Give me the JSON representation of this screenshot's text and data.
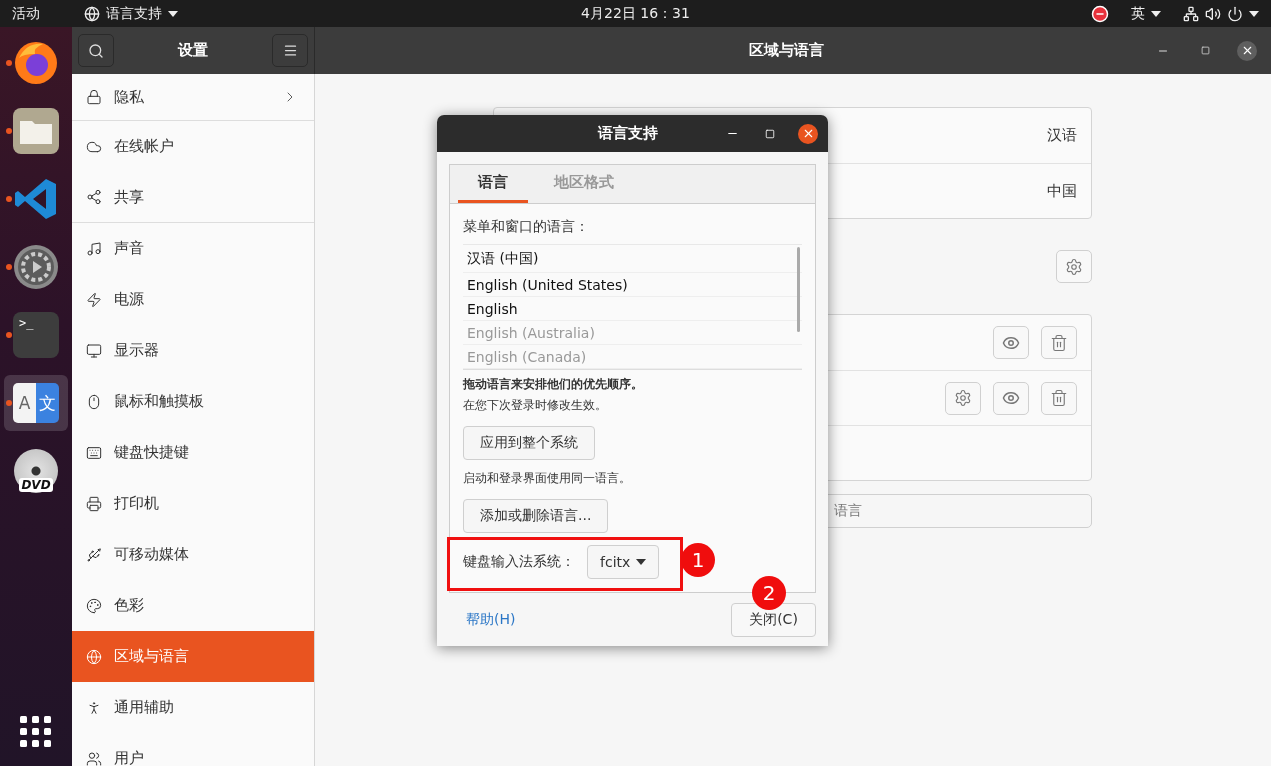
{
  "top_bar": {
    "activities": "活动",
    "app_menu": "语言支持",
    "clock": "4月22日  16：31",
    "input_method": "英"
  },
  "dock": {
    "apps": [
      {
        "kind": "browser",
        "running": true,
        "selected": false
      },
      {
        "kind": "files",
        "running": true,
        "selected": false
      },
      {
        "kind": "editor",
        "running": true,
        "selected": false
      },
      {
        "kind": "settings",
        "running": true,
        "selected": false
      },
      {
        "kind": "terminal",
        "running": true,
        "selected": false,
        "glyph": ">_"
      },
      {
        "kind": "language",
        "running": true,
        "selected": true,
        "glyphs": [
          "A",
          "文"
        ]
      },
      {
        "kind": "dvd",
        "selected": false,
        "glyph": "DVD"
      }
    ]
  },
  "settings_window": {
    "sidebar_title": "设置",
    "title": "区域与语言"
  },
  "sidebar": {
    "items": [
      {
        "label": "隐私",
        "selected": false,
        "has_arrow": true,
        "divider_after": true
      },
      {
        "label": "在线帐户",
        "selected": false,
        "has_arrow": false,
        "divider_after": false
      },
      {
        "label": "共享",
        "selected": false,
        "has_arrow": false,
        "divider_after": true
      },
      {
        "label": "声音",
        "selected": false,
        "has_arrow": false,
        "divider_after": false
      },
      {
        "label": "电源",
        "selected": false,
        "has_arrow": false,
        "divider_after": false
      },
      {
        "label": "显示器",
        "selected": false,
        "has_arrow": false,
        "divider_after": false
      },
      {
        "label": "鼠标和触摸板",
        "selected": false,
        "has_arrow": false,
        "divider_after": false
      },
      {
        "label": "键盘快捷键",
        "selected": false,
        "has_arrow": false,
        "divider_after": false
      },
      {
        "label": "打印机",
        "selected": false,
        "has_arrow": false,
        "divider_after": false
      },
      {
        "label": "可移动媒体",
        "selected": false,
        "has_arrow": false,
        "divider_after": false
      },
      {
        "label": "色彩",
        "selected": false,
        "has_arrow": false,
        "divider_after": false
      },
      {
        "label": "区域与语言",
        "selected": true,
        "has_arrow": false,
        "divider_after": false
      },
      {
        "label": "通用辅助",
        "selected": false,
        "has_arrow": false,
        "divider_after": false
      },
      {
        "label": "用户",
        "selected": false,
        "has_arrow": false,
        "divider_after": false
      }
    ]
  },
  "region_panel": {
    "rows": [
      {
        "value": "汉语"
      },
      {
        "value": "中国"
      }
    ]
  },
  "input_sources": {
    "rows": [
      {
        "has_settings": false,
        "has_actions": true
      },
      {
        "has_settings": true,
        "has_actions": true
      },
      {
        "has_settings": false,
        "has_actions": false
      }
    ]
  },
  "manage_field": {
    "text": "语言"
  },
  "dialog": {
    "title": "语言支持",
    "tabs": [
      {
        "label": "语言",
        "selected": true
      },
      {
        "label": "地区格式",
        "selected": false
      }
    ],
    "list_label": "菜单和窗口的语言：",
    "languages": [
      {
        "label": "汉语 (中国)",
        "dimmed": false
      },
      {
        "label": "English (United States)",
        "dimmed": false
      },
      {
        "label": "English",
        "dimmed": false
      },
      {
        "label": "English (Australia)",
        "dimmed": true
      },
      {
        "label": "English (Canada)",
        "dimmed": true
      }
    ],
    "drag_hint": "拖动语言来安排他们的优先顺序。",
    "login_hint": "在您下次登录时修改生效。",
    "apply_button": "应用到整个系统",
    "login_screen_hint": "启动和登录界面使用同一语言。",
    "add_remove_button": "添加或删除语言...",
    "keyboard_label": "键盘输入法系统：",
    "keyboard_value": "fcitx",
    "help_link": "帮助(H)",
    "close_button": "关闭(C)"
  },
  "annotations": [
    {
      "number": "1"
    },
    {
      "number": "2"
    }
  ]
}
